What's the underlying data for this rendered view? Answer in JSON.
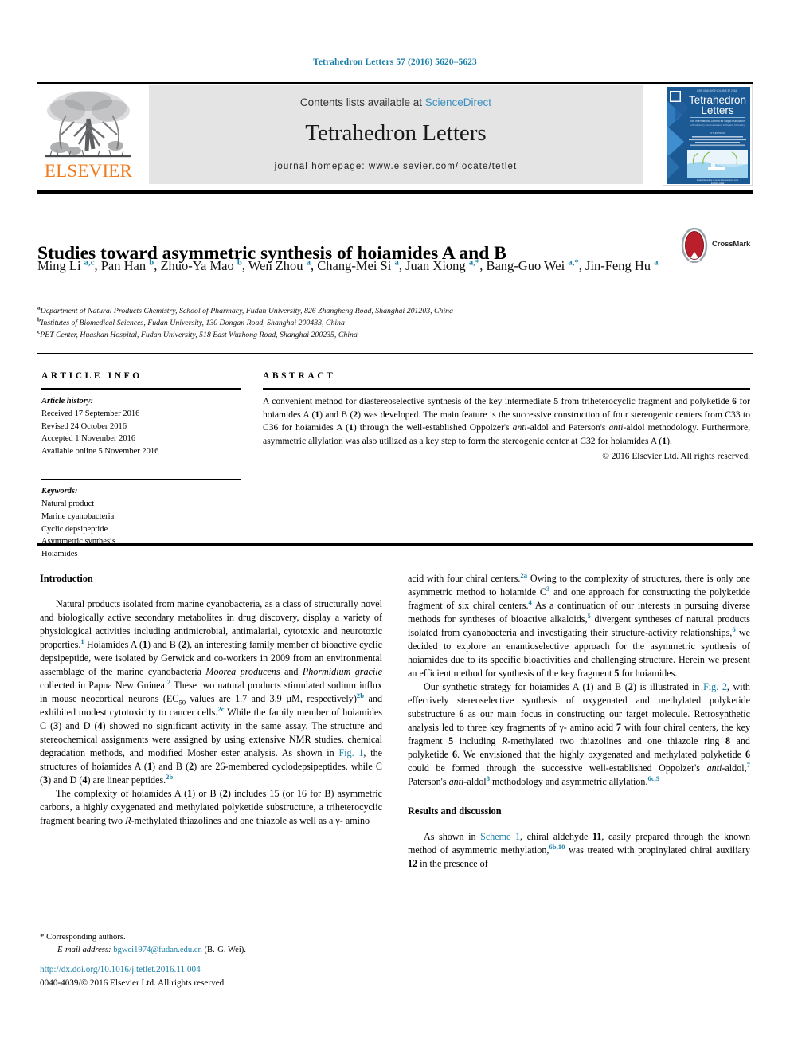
{
  "running_head": "Tetrahedron Letters 57 (2016) 5620–5623",
  "masthead": {
    "contents_prefix": "Contents lists available at",
    "sciencedirect": "ScienceDirect",
    "journal_title": "Tetrahedron Letters",
    "homepage": "journal homepage: www.elsevier.com/locate/tetlet",
    "publisher_wordmark": "ELSEVIER",
    "cover_title_line1": "Tetrahedron",
    "cover_title_line2": "Letters"
  },
  "article": {
    "title": "Studies toward asymmetric synthesis of hoiamides A and B",
    "crossmark_label": "CrossMark",
    "authors_html": "Ming Li <sup>a,c</sup>, Pan Han <sup>b</sup>, Zhuo-Ya Mao <sup>b</sup>, Wen Zhou <sup>a</sup>, Chang-Mei Si <sup>a</sup>, Juan Xiong <sup>a,</sup><sup>*</sup>, Bang-Guo Wei <sup>a,</sup><sup>*</sup>, Jin-Feng Hu <sup>a</sup>",
    "affiliations": [
      {
        "marker": "a",
        "text": "Department of Natural Products Chemistry, School of Pharmacy, Fudan University, 826 Zhangheng Road, Shanghai 201203, China"
      },
      {
        "marker": "b",
        "text": "Institutes of Biomedical Sciences, Fudan University, 130 Dongan Road, Shanghai 200433, China"
      },
      {
        "marker": "c",
        "text": "PET Center, Huashan Hospital, Fudan University, 518 East Wuzhong Road, Shanghai 200235, China"
      }
    ]
  },
  "article_info": {
    "heading": "ARTICLE INFO",
    "history_label": "Article history:",
    "history": [
      "Received 17 September 2016",
      "Revised 24 October 2016",
      "Accepted 1 November 2016",
      "Available online 5 November 2016"
    ],
    "keywords_label": "Keywords:",
    "keywords": [
      "Natural product",
      "Marine cyanobacteria",
      "Cyclic depsipeptide",
      "Asymmetric synthesis",
      "Hoiamides"
    ]
  },
  "abstract": {
    "heading": "ABSTRACT",
    "text_html": "A convenient method for diastereoselective synthesis of the key intermediate <b>5</b> from triheterocyclic fragment and polyketide <b>6</b> for hoiamides A (<b>1</b>) and B (<b>2</b>) was developed. The main feature is the successive construction of four stereogenic centers from C33 to C36 for hoiamides A (<b>1</b>) through the well-established Oppolzer's <i>anti</i>-aldol and Paterson's <i>anti</i>-aldol methodology. Furthermore, asymmetric allylation was also utilized as a key step to form the stereogenic center at C32 for hoiamides A (<b>1</b>).",
    "copyright": "© 2016 Elsevier Ltd. All rights reserved."
  },
  "body": {
    "intro_heading": "Introduction",
    "results_heading": "Results and discussion",
    "left_paragraphs_html": [
      "Natural products isolated from marine cyanobacteria, as a class of structurally novel and biologically active secondary metabolites in drug discovery, display a variety of physiological activities including antimicrobial, antimalarial, cytotoxic and neurotoxic properties.<span class=\"ref\">1</span> Hoiamides A (<b>1</b>) and B (<b>2</b>), an interesting family member of bioactive cyclic depsipeptide, were isolated by Gerwick and co-workers in 2009 from an environmental assemblage of the marine cyanobacteria <i>Moorea producens</i> and <i>Phormidium gracile</i> collected in Papua New Guinea.<span class=\"ref\">2</span> These two natural products stimulated sodium influx in mouse neocortical neurons (EC<span class=\"sub\">50</span> values are 1.7 and 3.9 µM, respectively)<span class=\"ref\">2b</span> and exhibited modest cytotoxicity to cancer cells.<span class=\"ref\">2c</span> While the family member of hoiamides C (<b>3</b>) and D (<b>4</b>) showed no significant activity in the same assay. The structure and stereochemical assignments were assigned by using extensive NMR studies, chemical degradation methods, and modified Mosher ester analysis. As shown in <span class=\"xlink\">Fig. 1</span>, the structures of hoiamides A (<b>1</b>) and B (<b>2</b>) are 26-membered cyclodepsipeptides, while C (<b>3</b>) and D (<b>4</b>) are linear peptides.<span class=\"ref\">2b</span>",
      "The complexity of hoiamides A (<b>1</b>) or B (<b>2</b>) includes 15 (or 16 for B) asymmetric carbons, a highly oxygenated and methylated polyketide substructure, a triheterocyclic fragment bearing two <i>R</i>-methylated thiazolines and one thiazole as well as a γ- amino"
    ],
    "right_paragraphs_html": [
      "acid with four chiral centers.<span class=\"ref\">2a</span> Owing to the complexity of structures, there is only one asymmetric method to hoiamide C<span class=\"ref\">3</span> and one approach for constructing the polyketide fragment of six chiral centers.<span class=\"ref\">4</span> As a continuation of our interests in pursuing diverse methods for syntheses of bioactive alkaloids,<span class=\"ref\">5</span> divergent syntheses of natural products isolated from cyanobacteria and investigating their structure-activity relationships,<span class=\"ref\">6</span> we decided to explore an enantioselective approach for the asymmetric synthesis of hoiamides due to its specific bioactivities and challenging structure. Herein we present an efficient method for synthesis of the key fragment <b>5</b> for hoiamides.",
      "Our synthetic strategy for hoiamides A (<b>1</b>) and B (<b>2</b>) is illustrated in <span class=\"xlink\">Fig. 2</span>, with effectively stereoselective synthesis of oxygenated and methylated polyketide substructure <b>6</b> as our main focus in constructing our target molecule. Retrosynthetic analysis led to three key fragments of γ- amino acid <b>7</b> with four chiral centers, the key fragment <b>5</b> including <i>R</i>-methylated two thiazolines and one thiazole ring <b>8</b> and polyketide <b>6</b>. We envisioned that the highly oxygenated and methylated polyketide <b>6</b> could be formed through the successive well-established Oppolzer's <i>anti</i>-aldol,<span class=\"ref\">7</span> Paterson's <i>anti</i>-aldol<span class=\"ref\">8</span> methodology and asymmetric allylation.<span class=\"ref\">6c,9</span>"
    ],
    "results_paragraph_html": "As shown in <span class=\"xlink\">Scheme 1</span>, chiral aldehyde <b>11</b>, easily prepared through the known method of asymmetric methylation,<span class=\"ref\">6b,10</span> was treated with propinylated chiral auxiliary <b>12</b> in the presence of"
  },
  "footnote": {
    "star": "*",
    "corresponding": "Corresponding authors.",
    "email_label": "E-mail address:",
    "email": "bgwei1974@fudan.edu.cn",
    "email_owner": "(B.-G. Wei)."
  },
  "footer": {
    "doi": "http://dx.doi.org/10.1016/j.tetlet.2016.11.004",
    "issn_copyright": "0040-4039/© 2016 Elsevier Ltd. All rights reserved."
  },
  "colors": {
    "link": "#1a7fa8",
    "elsevier_orange": "#ef7c20",
    "masthead_bg": "#e4e4e4"
  }
}
